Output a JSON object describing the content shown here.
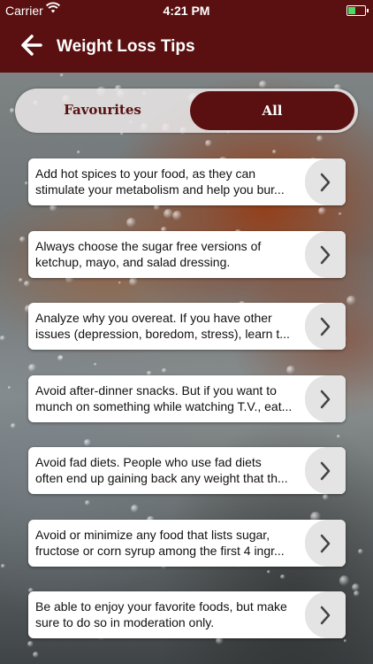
{
  "status_bar": {
    "carrier": "Carrier",
    "time": "4:21 PM"
  },
  "header": {
    "title": "Weight Loss Tips"
  },
  "tabs": [
    {
      "label": "Favourites",
      "selected": false
    },
    {
      "label": "All",
      "selected": true
    }
  ],
  "colors": {
    "brand": "#5a1010"
  },
  "tips": [
    {
      "line1": "Add hot spices to your food, as they can",
      "line2": "stimulate your metabolism and help you bur..."
    },
    {
      "line1": "Always choose the sugar free versions of",
      "line2": "ketchup, mayo, and salad dressing."
    },
    {
      "line1": "Analyze why you overeat. If you have other",
      "line2": "issues (depression, boredom, stress), learn t..."
    },
    {
      "line1": "Avoid after-dinner snacks.  But if you want to",
      "line2": "munch on something while watching T.V., eat..."
    },
    {
      "line1": "Avoid fad diets.  People who use fad diets",
      "line2": "often end up gaining back any weight that th..."
    },
    {
      "line1": "Avoid or minimize any food that lists sugar,",
      "line2": "fructose or corn syrup among the first 4 ingr..."
    },
    {
      "line1": "Be able to enjoy your favorite foods, but make",
      "line2": "sure to do so in moderation only."
    }
  ]
}
